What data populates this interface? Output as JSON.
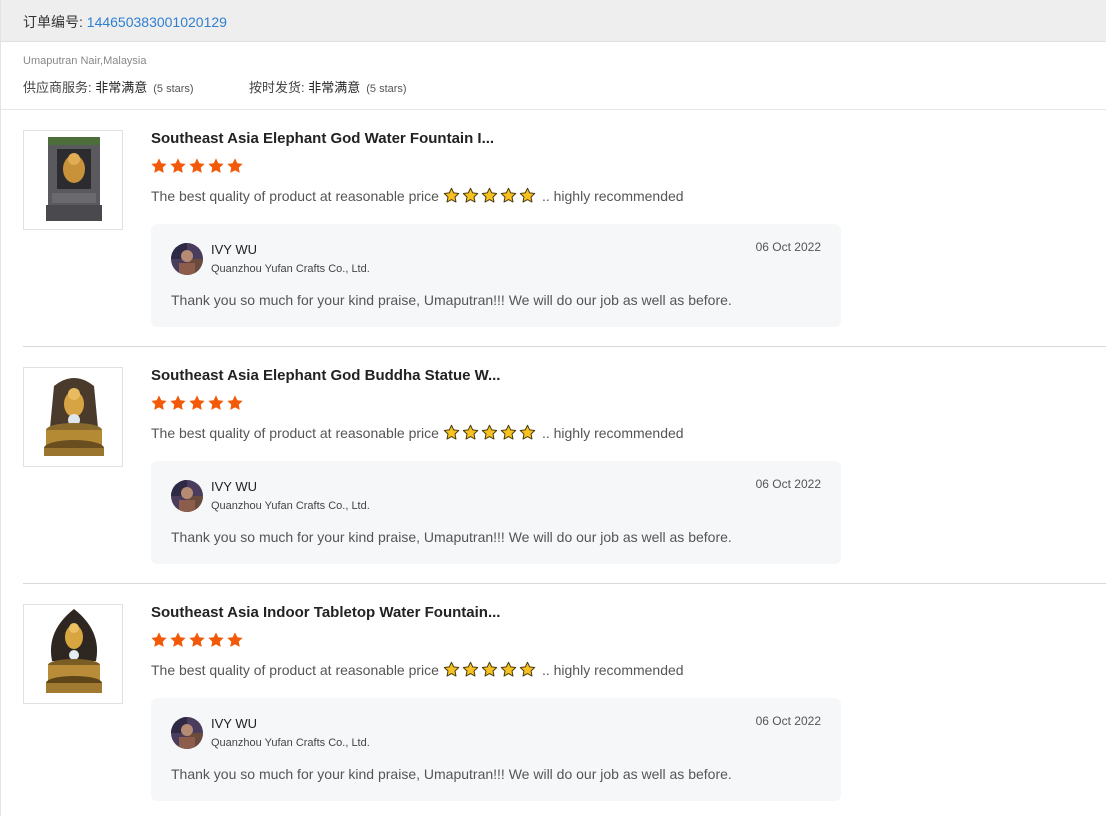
{
  "order": {
    "label": "订单编号: ",
    "number": "144650383001020129"
  },
  "buyer": {
    "name_country": "Umaputran Nair,Malaysia"
  },
  "seller_ratings": {
    "service_label": "供应商服务: ",
    "service_value": "非常满意",
    "service_stars": "(5 stars)",
    "shipping_label": "按时发货: ",
    "shipping_value": "非常满意",
    "shipping_stars": "(5 stars)"
  },
  "colors": {
    "accent_link": "#2f7fd1",
    "rating_star": "#f25a0a",
    "emoji_star": "#f7c21f"
  },
  "reviews": [
    {
      "product_title": "Southeast Asia Elephant God Water Fountain I...",
      "rating": 5,
      "comment_before": "The best quality of product at reasonable price",
      "comment_after": ".. highly recommended",
      "reply": {
        "name": "IVY WU",
        "company": "Quanzhou Yufan Crafts Co., Ltd.",
        "date": "06 Oct 2022",
        "text": "Thank you so much for your kind praise, Umaputran!!! We will do our job as well as before."
      }
    },
    {
      "product_title": "Southeast Asia Elephant God Buddha Statue W...",
      "rating": 5,
      "comment_before": "The best quality of product at reasonable price",
      "comment_after": ".. highly recommended",
      "reply": {
        "name": "IVY WU",
        "company": "Quanzhou Yufan Crafts Co., Ltd.",
        "date": "06 Oct 2022",
        "text": "Thank you so much for your kind praise, Umaputran!!! We will do our job as well as before."
      }
    },
    {
      "product_title": "Southeast Asia Indoor Tabletop Water Fountain...",
      "rating": 5,
      "comment_before": "The best quality of product at reasonable price",
      "comment_after": ".. highly recommended",
      "reply": {
        "name": "IVY WU",
        "company": "Quanzhou Yufan Crafts Co., Ltd.",
        "date": "06 Oct 2022",
        "text": "Thank you so much for your kind praise, Umaputran!!! We will do our job as well as before."
      }
    }
  ]
}
